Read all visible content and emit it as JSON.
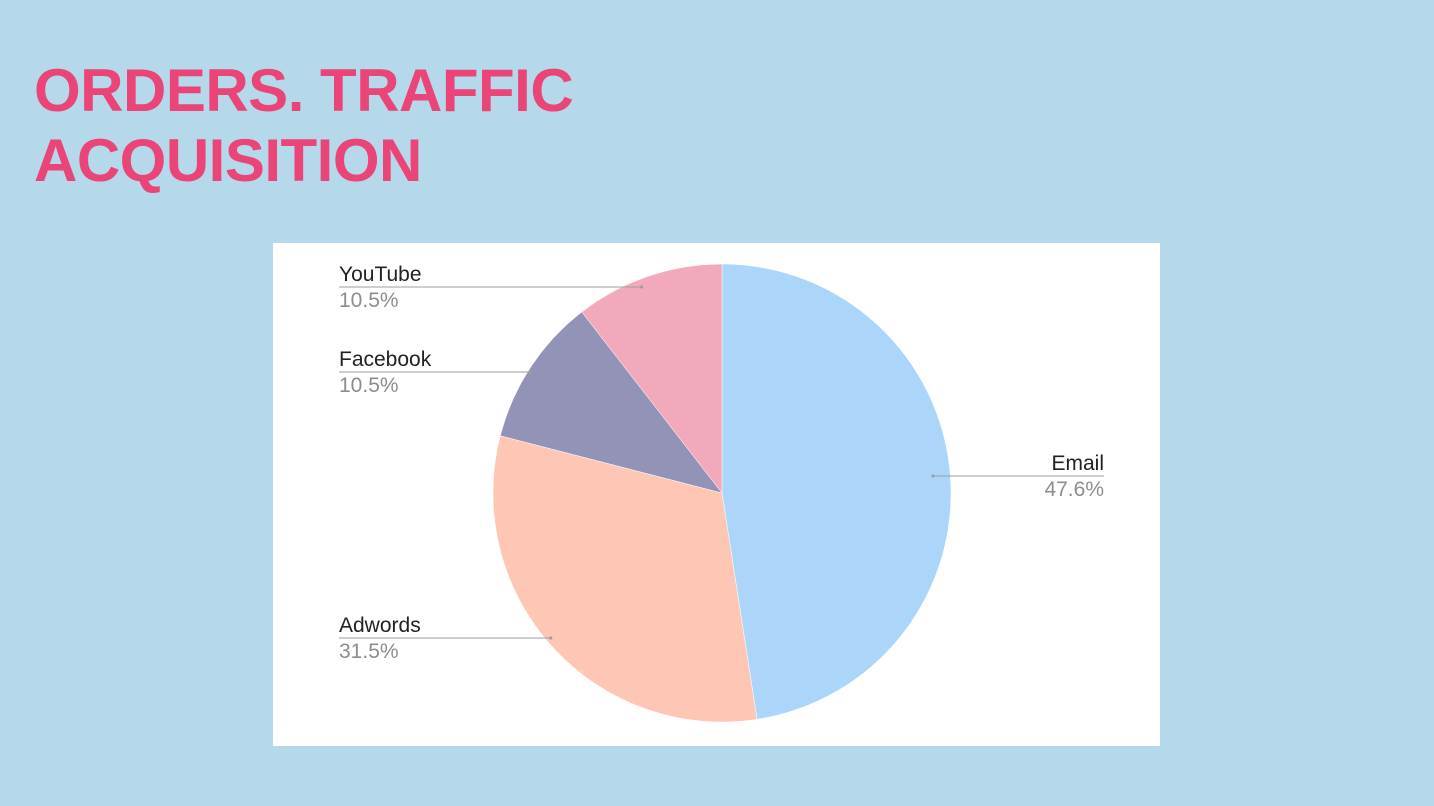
{
  "slide": {
    "title_line1": "ORDERS. TRAFFIC",
    "title_line2": "ACQUISITION"
  },
  "chart_data": {
    "type": "pie",
    "title": "",
    "slices": [
      {
        "name": "Email",
        "value": 47.6,
        "label": "47.6%",
        "color": "#acd5fa",
        "side": "right"
      },
      {
        "name": "Adwords",
        "value": 31.5,
        "label": "31.5%",
        "color": "#fec6b5",
        "side": "left"
      },
      {
        "name": "Facebook",
        "value": 10.5,
        "label": "10.5%",
        "color": "#9392b7",
        "side": "left"
      },
      {
        "name": "YouTube",
        "value": 10.5,
        "label": "10.5%",
        "color": "#f3a9bc",
        "side": "left"
      }
    ],
    "start_angle": "12 o'clock",
    "direction": "clockwise",
    "legend": "none (callout labels)",
    "colors": {
      "title": "#ea4478",
      "background": "#b5d8ea",
      "panel": "#ffffff"
    }
  }
}
